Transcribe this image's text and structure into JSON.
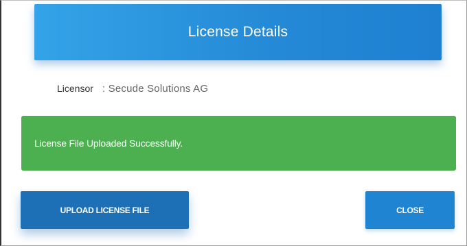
{
  "dialog": {
    "title": "License Details"
  },
  "details": {
    "licensor_label": "Licensor",
    "licensor_value": ": Secude Solutions AG"
  },
  "alert": {
    "message": "License File Uploaded Successfully.",
    "type": "success",
    "color": "#4cb050"
  },
  "actions": {
    "upload_label": "UPLOAD LICENSE FILE",
    "close_label": "CLOSE"
  },
  "colors": {
    "header": "#2489d6",
    "upload_button": "#1d6fb6",
    "close_button": "#1f85d2"
  }
}
